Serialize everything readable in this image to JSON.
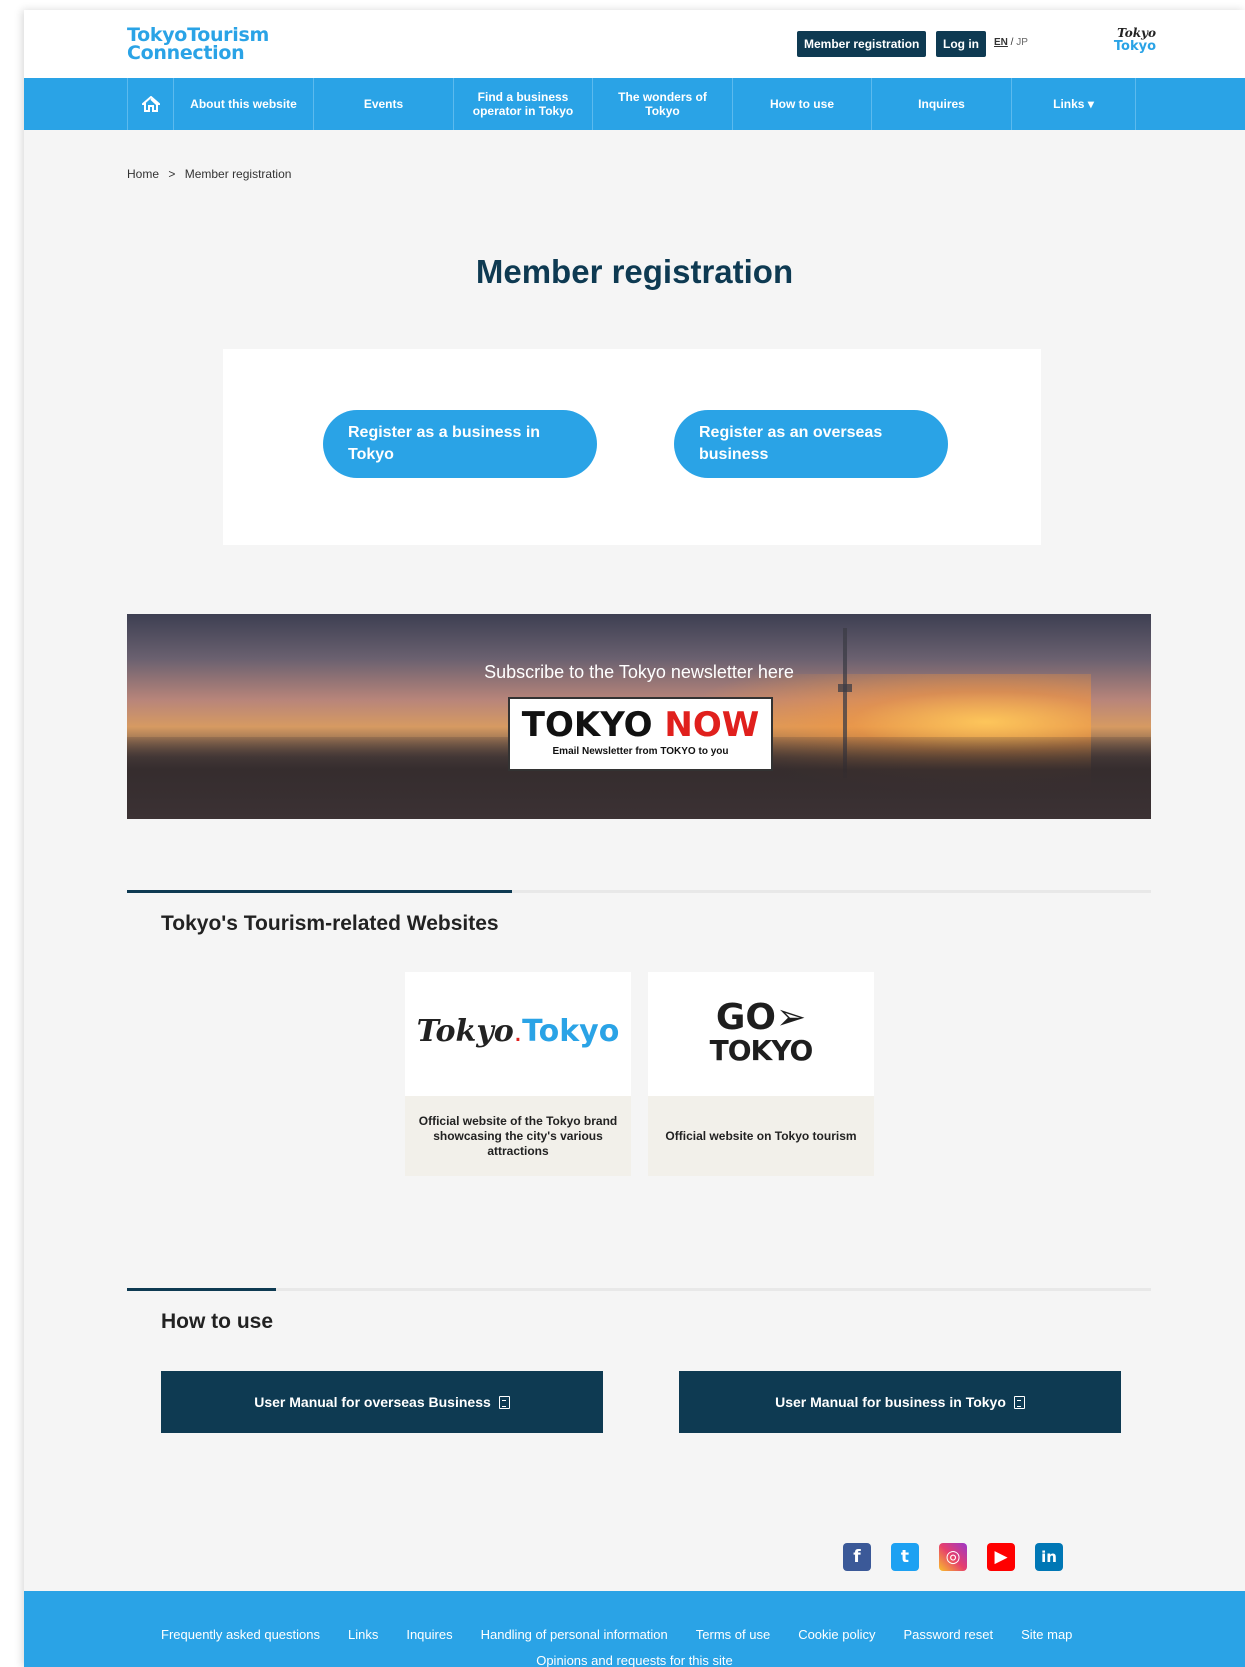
{
  "header": {
    "logo_line1": "TokyoTourism",
    "logo_line2": "Connection",
    "member_registration": "Member registration",
    "login": "Log in",
    "lang_en": "EN",
    "lang_sep": " / ",
    "lang_jp": "JP",
    "tt_logo_a": "Tokyo",
    "tt_logo_b": "Tokyo"
  },
  "nav": {
    "items": [
      "About this website",
      "Events",
      "Find a business operator in Tokyo",
      "The wonders of Tokyo",
      "How to use",
      "Inquires",
      "Links ▾"
    ]
  },
  "breadcrumb": {
    "home": "Home",
    "sep": ">",
    "current": "Member registration"
  },
  "main": {
    "title": "Member registration",
    "register_tokyo": "Register as a business in Tokyo",
    "register_overseas": "Register as an overseas business"
  },
  "banner": {
    "text": "Subscribe to the Tokyo newsletter here",
    "title_a": "TOKYO ",
    "title_b": "NOW",
    "subtitle": "Email Newsletter from TOKYO to you"
  },
  "websites": {
    "title": "Tokyo's Tourism-related Websites",
    "cards": [
      {
        "logo_a": "Tokyo",
        "logo_b": "Tokyo",
        "desc": "Official website of the Tokyo brand showcasing the city's various attractions"
      },
      {
        "logo_a": "GO➢",
        "logo_b": "TOKYO",
        "desc": "Official website on Tokyo tourism"
      }
    ]
  },
  "howto": {
    "title": "How to use",
    "manual_overseas": "User Manual for overseas Business",
    "manual_tokyo": "User Manual for business in Tokyo"
  },
  "social": {
    "facebook": "f",
    "twitter": "t",
    "instagram": "◎",
    "youtube": "▶",
    "linkedin": "in",
    "colors": {
      "facebook": "#3b5998",
      "twitter": "#1da1f2",
      "instagram": "#d6249f",
      "youtube": "#ff0000",
      "linkedin": "#0077b5"
    }
  },
  "footer": {
    "links": [
      "Frequently asked questions",
      "Links",
      "Inquires",
      "Handling of personal information",
      "Terms of use",
      "Cookie policy",
      "Password reset",
      "Site map"
    ],
    "links2": "Opinions and requests for this site"
  },
  "colors": {
    "accent": "#2aa3e6",
    "navy": "#0e3a52",
    "background": "#f5f5f5"
  }
}
